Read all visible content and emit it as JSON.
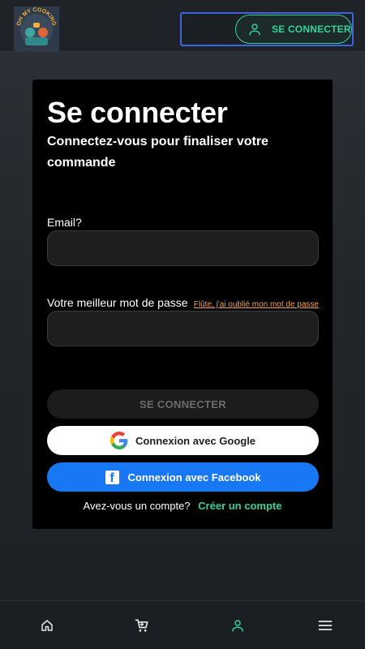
{
  "header": {
    "logo_text": "OH MY COOKING BUDDY'S",
    "signin_button_label": "SE CONNECTER"
  },
  "login": {
    "title": "Se connecter",
    "subtitle": "Connectez-vous pour finaliser votre commande",
    "email_label": "Email?",
    "email_value": "",
    "password_label": "Votre meilleur mot de passe",
    "password_value": "",
    "forgot_link": "Flûte, j'ai oublié mon mot de passe",
    "submit_label": "SE CONNECTER",
    "google_label": "Connexion avec Google",
    "facebook_label": "Connexion avec Facebook",
    "account_question": "Avez-vous un compte?",
    "create_account_link": "Créer un compte"
  },
  "colors": {
    "accent": "#34d399",
    "facebook": "#1877f2",
    "forgot_link": "#f2a35b",
    "card_bg": "#000000"
  },
  "bottom_nav": {
    "items": [
      {
        "icon": "home-icon",
        "active": false
      },
      {
        "icon": "cart-icon",
        "active": false
      },
      {
        "icon": "user-icon",
        "active": true
      },
      {
        "icon": "menu-icon",
        "active": false
      }
    ]
  }
}
